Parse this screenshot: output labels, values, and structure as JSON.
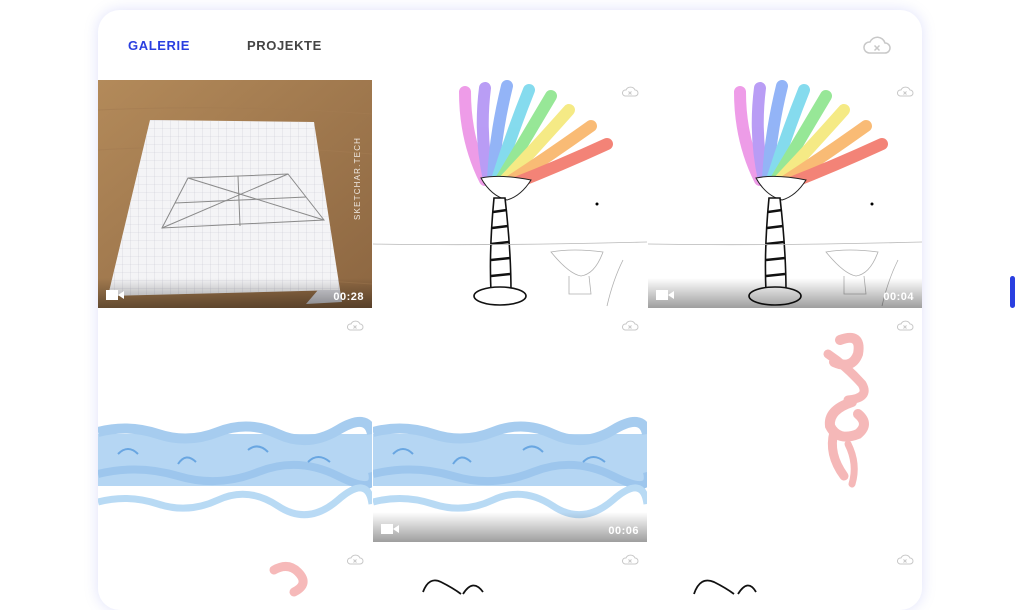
{
  "tabs": {
    "gallery": "GALERIE",
    "projects": "PROJEKTE"
  },
  "colors": {
    "accent": "#2a3fe0",
    "inactive_tab": "#444444",
    "cloud_icon": "#c8c8c8"
  },
  "icons": {
    "header_cloud": "cloud-off-icon",
    "tile_cloud": "cloud-off-icon",
    "video": "video-camera-icon"
  },
  "gallery": {
    "items": [
      {
        "kind": "video",
        "content": "photo-of-grid-paper-sketch",
        "watermark": "SKETCHAR.TECH",
        "duration": "00:28"
      },
      {
        "kind": "drawing",
        "content": "rainbow-palm-tree"
      },
      {
        "kind": "video",
        "content": "rainbow-palm-tree",
        "duration": "00:04"
      },
      {
        "kind": "drawing",
        "content": "blue-watercolor-wave"
      },
      {
        "kind": "video",
        "content": "blue-watercolor-wave",
        "duration": "00:06"
      },
      {
        "kind": "drawing",
        "content": "pink-brush-strokes"
      }
    ]
  }
}
